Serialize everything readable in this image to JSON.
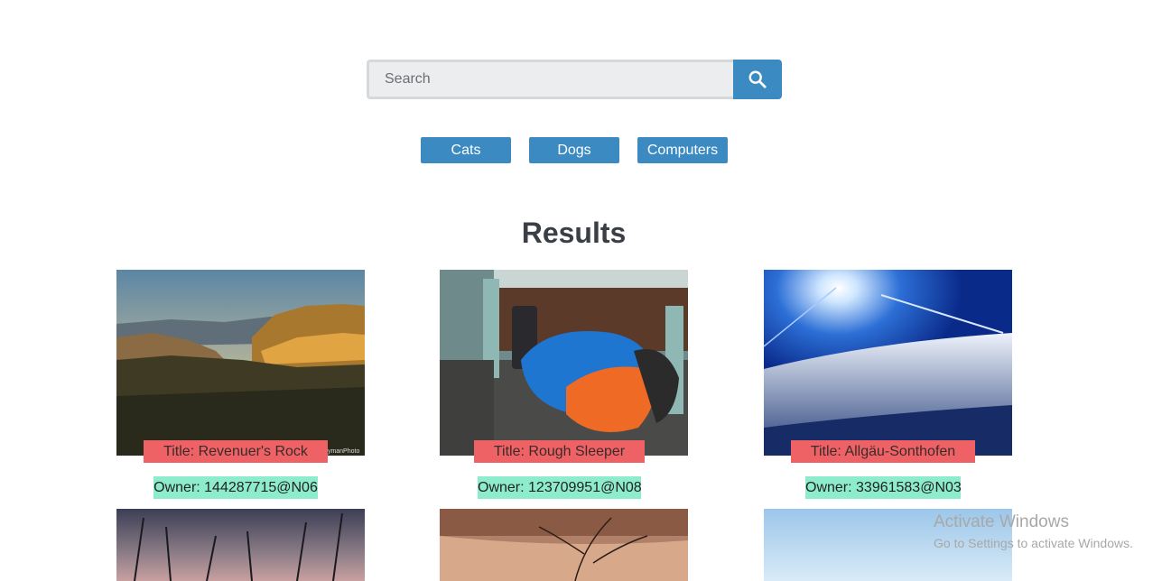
{
  "search": {
    "placeholder": "Search",
    "button_icon": "search-icon"
  },
  "filters": [
    {
      "label": "Cats"
    },
    {
      "label": "Dogs"
    },
    {
      "label": "Computers"
    }
  ],
  "results": {
    "heading": "Results",
    "cards": [
      {
        "title": "Title: Revenuer's Rock",
        "owner": "Owner: 144287715@N06",
        "photo_credit": "tymanPhoto"
      },
      {
        "title": "Title: Rough Sleeper",
        "owner": "Owner: 123709951@N08"
      },
      {
        "title": "Title: Allgäu-Sonthofen",
        "owner": "Owner: 33961583@N03"
      }
    ]
  },
  "watermark": {
    "line1": "Activate Windows",
    "line2": "Go to Settings to activate Windows."
  },
  "colors": {
    "accent": "#3c8ac2",
    "title_tag": "#ee6266",
    "owner_tag": "#8ceccb",
    "heading": "#3a3f46"
  }
}
